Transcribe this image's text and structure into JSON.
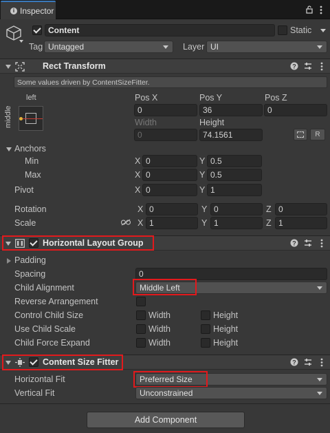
{
  "tab": {
    "title": "Inspector"
  },
  "object": {
    "name": "Content",
    "static_label": "Static",
    "tag_label": "Tag",
    "tag_value": "Untagged",
    "layer_label": "Layer",
    "layer_value": "UI"
  },
  "rect_transform": {
    "title": "Rect Transform",
    "info": "Some values driven by ContentSizeFitter.",
    "anchor_h": "left",
    "anchor_v": "middle",
    "pos_x_label": "Pos X",
    "pos_y_label": "Pos Y",
    "pos_z_label": "Pos Z",
    "pos_x": "0",
    "pos_y": "36",
    "pos_z": "0",
    "width_label": "Width",
    "height_label": "Height",
    "width": "0",
    "height": "74.1561",
    "raw_btn": "R",
    "anchors_label": "Anchors",
    "min_label": "Min",
    "max_label": "Max",
    "pivot_label": "Pivot",
    "min_x": "0",
    "min_y": "0.5",
    "max_x": "0",
    "max_y": "0.5",
    "pivot_x": "0",
    "pivot_y": "1",
    "rotation_label": "Rotation",
    "scale_label": "Scale",
    "rot_x": "0",
    "rot_y": "0",
    "rot_z": "0",
    "scale_x": "1",
    "scale_y": "1",
    "scale_z": "1",
    "x": "X",
    "y": "Y",
    "z": "Z"
  },
  "hlg": {
    "title": "Horizontal Layout Group",
    "padding_label": "Padding",
    "spacing_label": "Spacing",
    "spacing": "0",
    "child_alignment_label": "Child Alignment",
    "child_alignment": "Middle Left",
    "reverse_label": "Reverse Arrangement",
    "control_size_label": "Control Child Size",
    "use_scale_label": "Use Child Scale",
    "force_expand_label": "Child Force Expand",
    "width": "Width",
    "height": "Height"
  },
  "csf": {
    "title": "Content Size Fitter",
    "h_fit_label": "Horizontal Fit",
    "h_fit": "Preferred Size",
    "v_fit_label": "Vertical Fit",
    "v_fit": "Unconstrained"
  },
  "add_component": "Add Component"
}
